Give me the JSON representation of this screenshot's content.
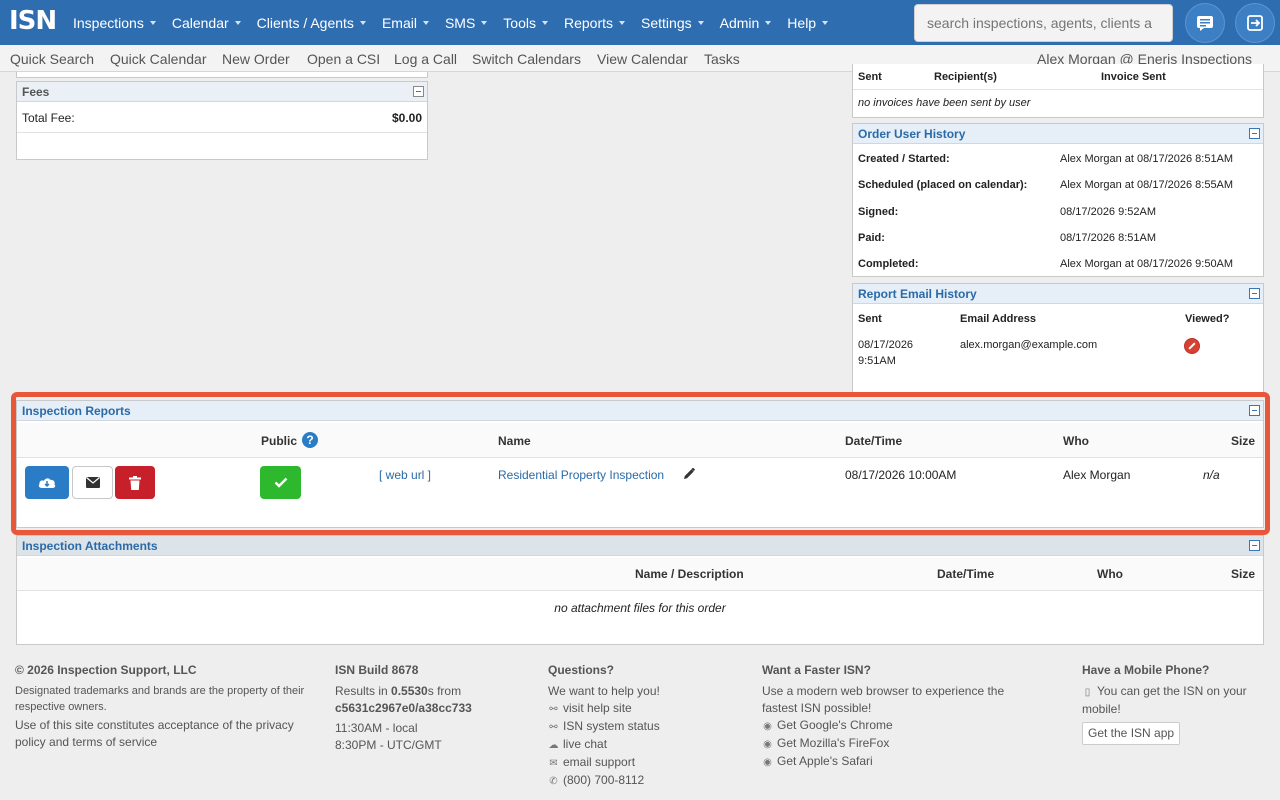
{
  "nav": {
    "logo": "ISN",
    "items": [
      {
        "label": "Inspections"
      },
      {
        "label": "Calendar"
      },
      {
        "label": "Clients / Agents"
      },
      {
        "label": "Email"
      },
      {
        "label": "SMS"
      },
      {
        "label": "Tools"
      },
      {
        "label": "Reports"
      },
      {
        "label": "Settings"
      },
      {
        "label": "Admin"
      },
      {
        "label": "Help"
      }
    ],
    "search_placeholder": "search inspections, agents, clients a"
  },
  "subnav": {
    "items": [
      "Quick Search",
      "Quick Calendar",
      "New Order",
      "Open a CSI",
      "Log a Call",
      "Switch Calendars",
      "View Calendar",
      "Tasks"
    ],
    "user": "Alex Morgan @ Eneris Inspections"
  },
  "fees": {
    "title": "Fees",
    "label": "Total Fee:",
    "value": "$0.00"
  },
  "invoices": {
    "headers": [
      "Sent",
      "Recipient(s)",
      "Invoice Sent"
    ],
    "empty": "no invoices have been sent by user"
  },
  "order_history": {
    "title": "Order User History",
    "rows": [
      {
        "label": "Created / Started:",
        "value": "Alex Morgan at 08/17/2026 8:51AM"
      },
      {
        "label": "Scheduled (placed on calendar):",
        "value": "Alex Morgan at 08/17/2026 8:55AM"
      },
      {
        "label": "Signed:",
        "value": "08/17/2026 9:52AM"
      },
      {
        "label": "Paid:",
        "value": "08/17/2026 8:51AM"
      },
      {
        "label": "Completed:",
        "value": "Alex Morgan at 08/17/2026 9:50AM"
      }
    ]
  },
  "report_email": {
    "title": "Report Email History",
    "headers": [
      "Sent",
      "Email Address",
      "Viewed?"
    ],
    "row": {
      "sent_date": "08/17/2026",
      "sent_time": "9:51AM",
      "email": "alex.morgan@example.com"
    }
  },
  "reports": {
    "title": "Inspection Reports",
    "headers": {
      "public": "Public",
      "name": "Name",
      "datetime": "Date/Time",
      "who": "Who",
      "size": "Size"
    },
    "row": {
      "web_url": "[ web url ]",
      "name": "Residential Property Inspection",
      "datetime": "08/17/2026 10:00AM",
      "who": "Alex Morgan",
      "size": "n/a"
    }
  },
  "attachments": {
    "title": "Inspection Attachments",
    "headers": {
      "name": "Name / Description",
      "datetime": "Date/Time",
      "who": "Who",
      "size": "Size"
    },
    "empty": "no attachment files for this order"
  },
  "footer": {
    "copyright": "© 2026 Inspection Support, LLC",
    "trademark": "Designated trademarks and brands are the property of their respective owners.",
    "terms": "Use of this site constitutes acceptance of the privacy policy and terms of service",
    "build": "ISN Build 8678",
    "results_prefix": "Results in ",
    "results_time": "0.5530",
    "results_suffix": "s from",
    "results_hash": "c5631c2967e0/a38cc733",
    "local_time": "11:30AM - local",
    "utc_time": "8:30PM - UTC/GMT",
    "questions_title": "Questions?",
    "questions_sub": "We want to help you!",
    "help_site": "visit help site",
    "system_status": "ISN system status",
    "live_chat": "live chat",
    "email_support": "email support",
    "phone": "(800) 700-8112",
    "faster_title": "Want a Faster ISN?",
    "faster_text": "Use a modern web browser to experience the fastest ISN possible!",
    "chrome": "Get Google's Chrome",
    "firefox": "Get Mozilla's FireFox",
    "safari": "Get Apple's Safari",
    "mobile_title": "Have a Mobile Phone?",
    "mobile_text": "You can get the ISN on your mobile!",
    "app_button": "Get the ISN app"
  }
}
